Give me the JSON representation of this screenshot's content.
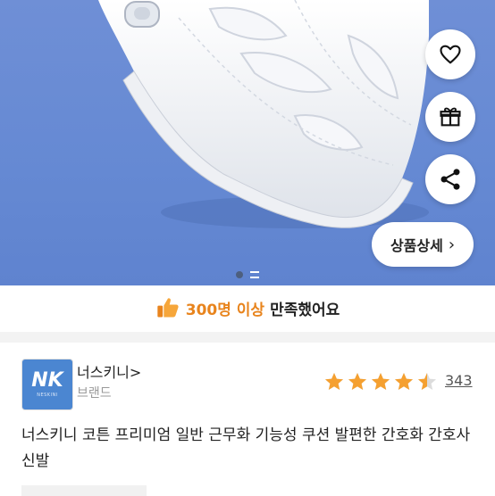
{
  "hero": {
    "image": "white-mesh-mule-sneaker",
    "background_color": "#6589d3",
    "actions": [
      {
        "icon": "heart-icon"
      },
      {
        "icon": "gift-icon"
      },
      {
        "icon": "share-icon"
      }
    ],
    "detail_button": {
      "label": "상품상세",
      "chevron": "›"
    },
    "pager": {
      "current": 1,
      "total": 2
    }
  },
  "satisfaction": {
    "icon": "thumbs-up-icon",
    "highlight": "300명 이상",
    "rest": "만족했어요"
  },
  "brand": {
    "logo_mark": "NK",
    "logo_caption": "NESKINI",
    "name": "너스키니",
    "chevron": ">",
    "subtitle": "브랜드"
  },
  "rating": {
    "score_out_of_5": 4.5,
    "review_count": "343",
    "star_color": "#f5a030"
  },
  "product": {
    "title": "너스키니 코튼 프리미엄 일반 근무화 기능성 쿠션 발편한 간호화 간호사 신발"
  }
}
